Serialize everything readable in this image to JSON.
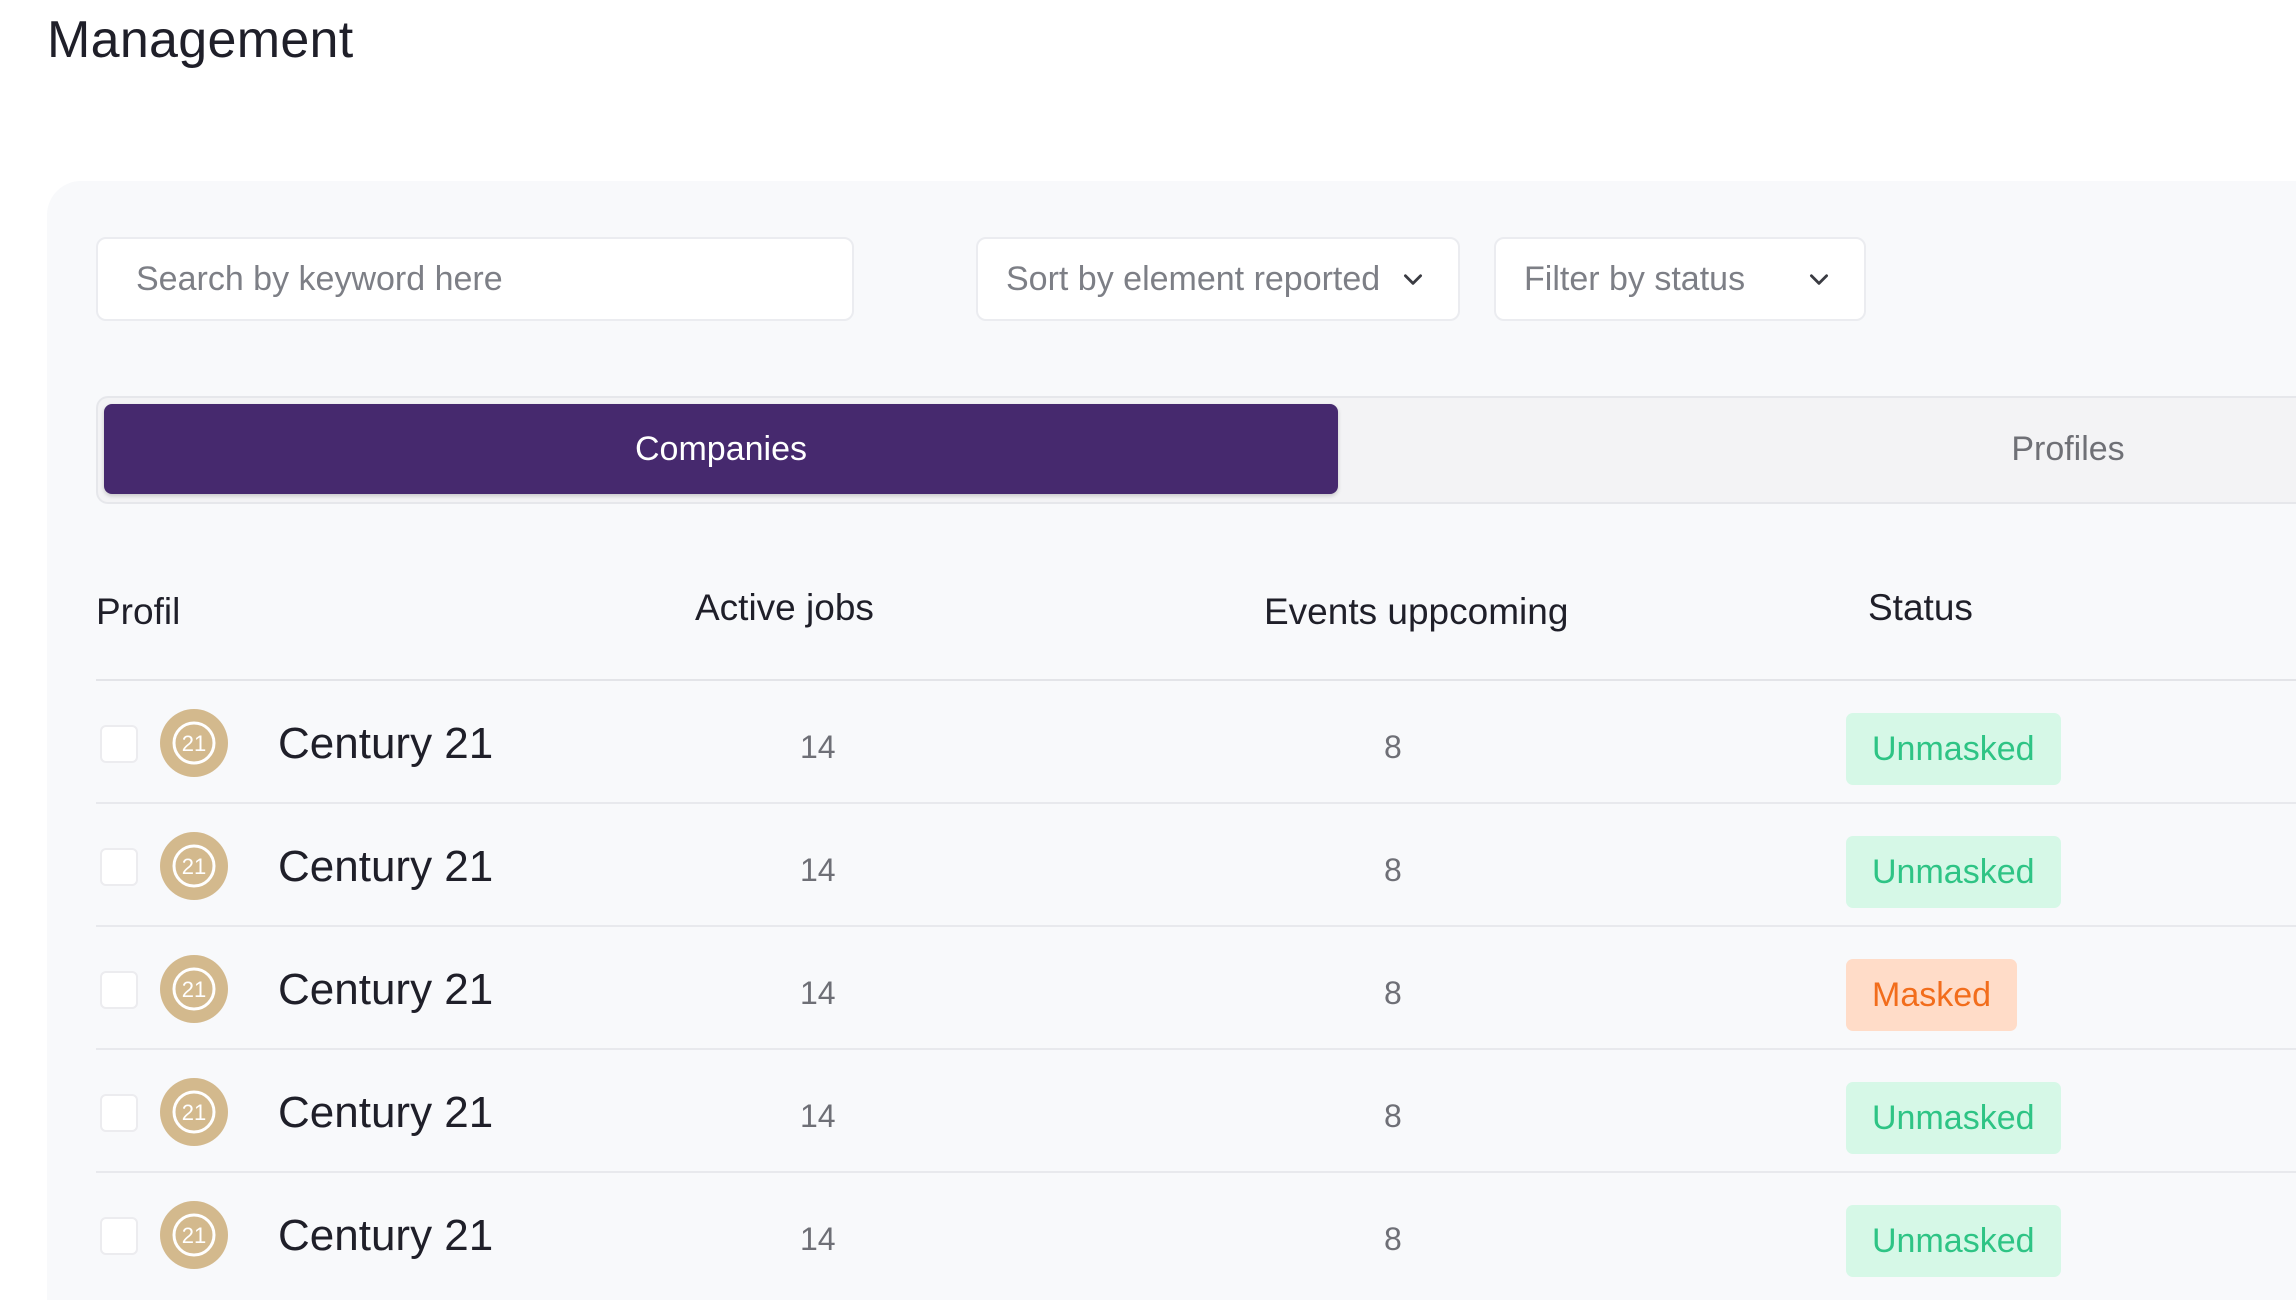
{
  "page": {
    "title": "Management"
  },
  "search": {
    "placeholder": "Search by keyword here"
  },
  "sort": {
    "label": "Sort by element reported",
    "icon": "chevron-down-icon"
  },
  "filter": {
    "label": "Filter by status",
    "icon": "chevron-down-icon"
  },
  "tabs": [
    {
      "label": "Companies",
      "active": true
    },
    {
      "label": "Profiles",
      "active": false
    }
  ],
  "table": {
    "headers": {
      "profil": "Profil",
      "active_jobs": "Active jobs",
      "events": "Events uppcoming",
      "status": "Status"
    },
    "rows": [
      {
        "name": "Century 21",
        "logo_text": "21",
        "active_jobs": "14",
        "events": "8",
        "status": "Unmasked",
        "status_type": "unmasked"
      },
      {
        "name": "Century 21",
        "logo_text": "21",
        "active_jobs": "14",
        "events": "8",
        "status": "Unmasked",
        "status_type": "unmasked"
      },
      {
        "name": "Century 21",
        "logo_text": "21",
        "active_jobs": "14",
        "events": "8",
        "status": "Masked",
        "status_type": "masked"
      },
      {
        "name": "Century 21",
        "logo_text": "21",
        "active_jobs": "14",
        "events": "8",
        "status": "Unmasked",
        "status_type": "unmasked"
      },
      {
        "name": "Century 21",
        "logo_text": "21",
        "active_jobs": "14",
        "events": "8",
        "status": "Unmasked",
        "status_type": "unmasked"
      }
    ]
  },
  "colors": {
    "accent": "#46296e",
    "unmasked_bg": "#d6f8e7",
    "unmasked_text": "#2ec485",
    "masked_bg": "#ffdcc8",
    "masked_text": "#f26d1c",
    "logo_gold": "#d3b98d"
  }
}
